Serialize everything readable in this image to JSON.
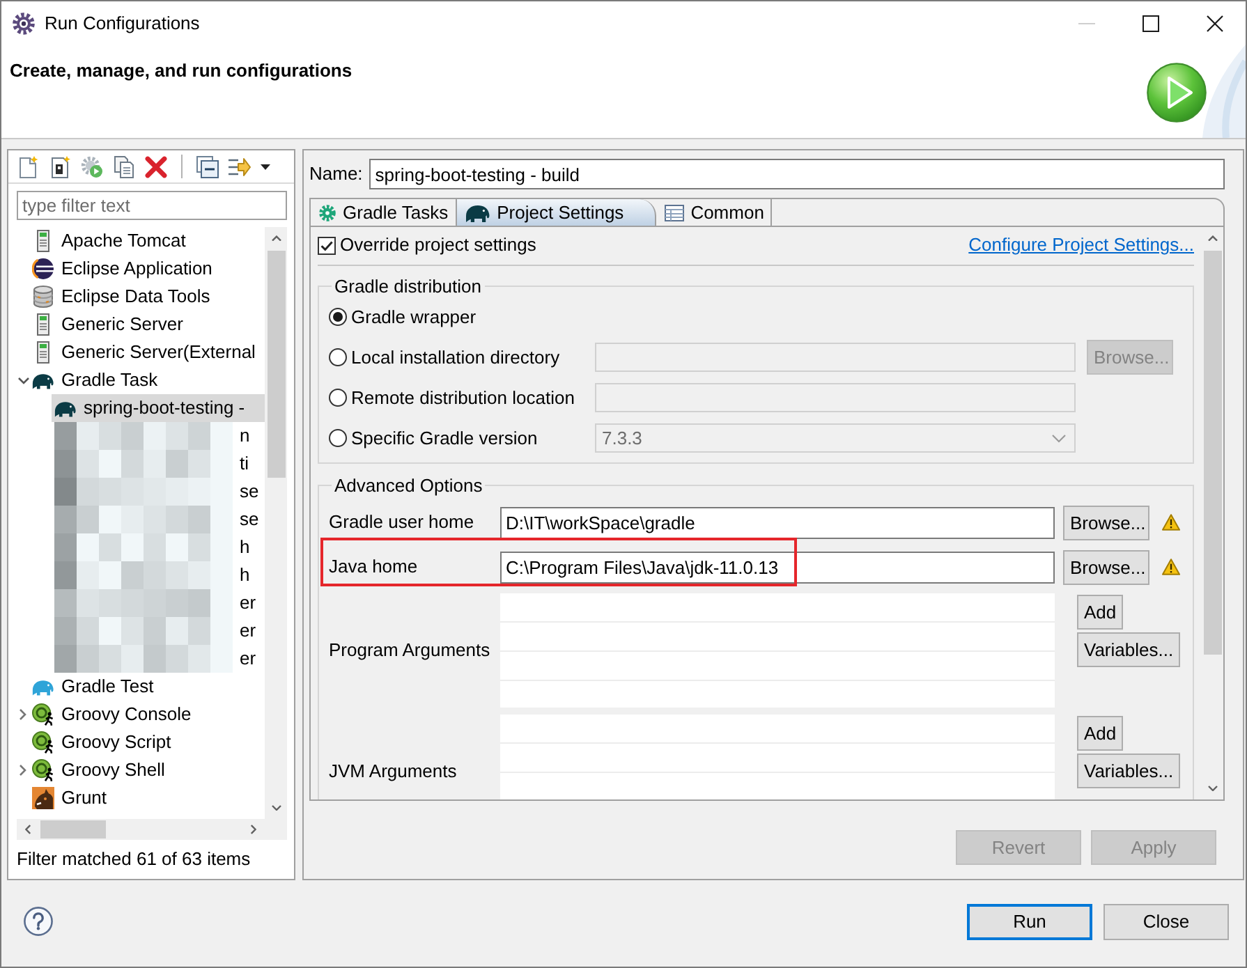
{
  "window": {
    "title": "Run Configurations",
    "controls": [
      {
        "kind": "minimize",
        "disabled": true
      },
      {
        "kind": "maximize",
        "disabled": false
      },
      {
        "kind": "close",
        "disabled": false
      }
    ]
  },
  "header": {
    "title": "Create, manage, and run configurations"
  },
  "left_panel": {
    "filter": {
      "placeholder": "type filter text"
    },
    "tree": [
      {
        "kind": "server",
        "label": "Apache Tomcat",
        "selected": false
      },
      {
        "kind": "eclipse",
        "label": "Eclipse Application",
        "selected": false
      },
      {
        "kind": "database",
        "label": "Eclipse Data Tools",
        "selected": false
      },
      {
        "kind": "server",
        "label": "Generic Server",
        "selected": false
      },
      {
        "kind": "server",
        "label": "Generic Server(External",
        "selected": false
      },
      {
        "kind": "gradle-task",
        "label": "Gradle Task",
        "selected": false,
        "expanded": true,
        "children": [
          {
            "kind": "gradle-task",
            "label": "spring-boot-testing -",
            "selected": true
          },
          {
            "kind": "redacted",
            "label": "n",
            "selected": false
          },
          {
            "kind": "redacted",
            "label": "ti",
            "selected": false
          },
          {
            "kind": "redacted",
            "label": "se",
            "selected": false
          },
          {
            "kind": "redacted",
            "label": "se",
            "selected": false
          },
          {
            "kind": "redacted",
            "label": "h",
            "selected": false
          },
          {
            "kind": "redacted",
            "label": "h",
            "selected": false
          },
          {
            "kind": "redacted",
            "label": "er",
            "selected": false
          },
          {
            "kind": "redacted",
            "label": "er",
            "selected": false
          },
          {
            "kind": "redacted",
            "label": "er",
            "selected": false
          }
        ]
      },
      {
        "kind": "gradle-test",
        "label": "Gradle Test",
        "selected": false
      },
      {
        "kind": "groovy",
        "label": "Groovy Console",
        "selected": false,
        "expanded": false
      },
      {
        "kind": "groovy",
        "label": "Groovy Script",
        "selected": false
      },
      {
        "kind": "groovy",
        "label": "Groovy Shell",
        "selected": false,
        "expanded": false
      },
      {
        "kind": "grunt",
        "label": "Grunt",
        "selected": false
      }
    ],
    "status": "Filter matched 61 of 63 items"
  },
  "name_field": {
    "label": "Name:",
    "value": "spring-boot-testing - build"
  },
  "tabs": [
    {
      "kind": "gear",
      "label": "Gradle Tasks",
      "selected": false
    },
    {
      "kind": "gradle",
      "label": "Project Settings",
      "selected": true
    },
    {
      "kind": "table",
      "label": "Common",
      "selected": false
    }
  ],
  "override": {
    "label": "Override project settings",
    "checked": true
  },
  "configure_link": "Configure Project Settings...",
  "gradle_distribution": {
    "title": "Gradle distribution",
    "options": [
      {
        "kind": "wrapper",
        "label": "Gradle wrapper",
        "selected": true
      },
      {
        "kind": "directory",
        "label": "Local installation directory",
        "selected": false,
        "button": "Browse..."
      },
      {
        "kind": "uri",
        "label": "Remote distribution location",
        "selected": false
      },
      {
        "kind": "version",
        "label": "Specific Gradle version",
        "selected": false,
        "value": "7.3.3"
      }
    ]
  },
  "advanced_options": {
    "title": "Advanced Options",
    "rows": [
      {
        "kind": "path",
        "label": "Gradle user home",
        "value": "D:\\IT\\workSpace\\gradle",
        "button": "Browse...",
        "warning": true,
        "highlighted": false
      },
      {
        "kind": "path",
        "label": "Java home",
        "value": "C:\\Program Files\\Java\\jdk-11.0.13",
        "button": "Browse...",
        "warning": true,
        "highlighted": true
      },
      {
        "kind": "list",
        "label": "Program Arguments",
        "buttons": [
          "Add",
          "Variables..."
        ]
      },
      {
        "kind": "list",
        "label": "JVM Arguments",
        "buttons": [
          "Add",
          "Variables..."
        ]
      }
    ]
  },
  "form_buttons": [
    {
      "label": "Revert",
      "disabled": true
    },
    {
      "label": "Apply",
      "disabled": true
    }
  ],
  "dialog_buttons": [
    {
      "label": "Run",
      "default": true
    },
    {
      "label": "Close",
      "default": false
    }
  ]
}
